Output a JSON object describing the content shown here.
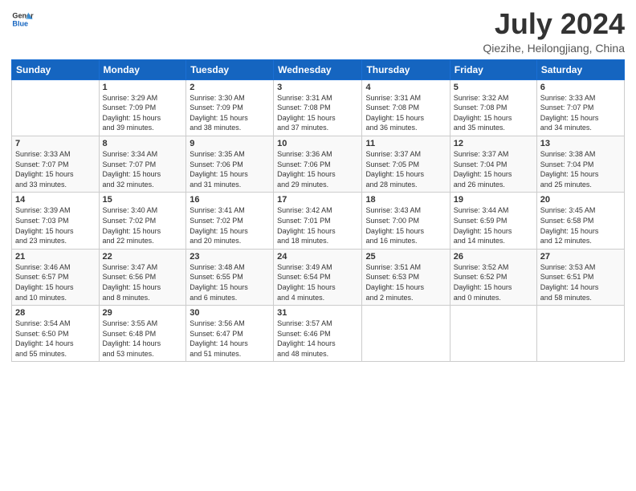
{
  "header": {
    "logo_line1": "General",
    "logo_line2": "Blue",
    "month_year": "July 2024",
    "location": "Qiezihe, Heilongjiang, China"
  },
  "weekdays": [
    "Sunday",
    "Monday",
    "Tuesday",
    "Wednesday",
    "Thursday",
    "Friday",
    "Saturday"
  ],
  "weeks": [
    [
      {
        "day": "",
        "info": ""
      },
      {
        "day": "1",
        "info": "Sunrise: 3:29 AM\nSunset: 7:09 PM\nDaylight: 15 hours\nand 39 minutes."
      },
      {
        "day": "2",
        "info": "Sunrise: 3:30 AM\nSunset: 7:09 PM\nDaylight: 15 hours\nand 38 minutes."
      },
      {
        "day": "3",
        "info": "Sunrise: 3:31 AM\nSunset: 7:08 PM\nDaylight: 15 hours\nand 37 minutes."
      },
      {
        "day": "4",
        "info": "Sunrise: 3:31 AM\nSunset: 7:08 PM\nDaylight: 15 hours\nand 36 minutes."
      },
      {
        "day": "5",
        "info": "Sunrise: 3:32 AM\nSunset: 7:08 PM\nDaylight: 15 hours\nand 35 minutes."
      },
      {
        "day": "6",
        "info": "Sunrise: 3:33 AM\nSunset: 7:07 PM\nDaylight: 15 hours\nand 34 minutes."
      }
    ],
    [
      {
        "day": "7",
        "info": "Sunrise: 3:33 AM\nSunset: 7:07 PM\nDaylight: 15 hours\nand 33 minutes."
      },
      {
        "day": "8",
        "info": "Sunrise: 3:34 AM\nSunset: 7:07 PM\nDaylight: 15 hours\nand 32 minutes."
      },
      {
        "day": "9",
        "info": "Sunrise: 3:35 AM\nSunset: 7:06 PM\nDaylight: 15 hours\nand 31 minutes."
      },
      {
        "day": "10",
        "info": "Sunrise: 3:36 AM\nSunset: 7:06 PM\nDaylight: 15 hours\nand 29 minutes."
      },
      {
        "day": "11",
        "info": "Sunrise: 3:37 AM\nSunset: 7:05 PM\nDaylight: 15 hours\nand 28 minutes."
      },
      {
        "day": "12",
        "info": "Sunrise: 3:37 AM\nSunset: 7:04 PM\nDaylight: 15 hours\nand 26 minutes."
      },
      {
        "day": "13",
        "info": "Sunrise: 3:38 AM\nSunset: 7:04 PM\nDaylight: 15 hours\nand 25 minutes."
      }
    ],
    [
      {
        "day": "14",
        "info": "Sunrise: 3:39 AM\nSunset: 7:03 PM\nDaylight: 15 hours\nand 23 minutes."
      },
      {
        "day": "15",
        "info": "Sunrise: 3:40 AM\nSunset: 7:02 PM\nDaylight: 15 hours\nand 22 minutes."
      },
      {
        "day": "16",
        "info": "Sunrise: 3:41 AM\nSunset: 7:02 PM\nDaylight: 15 hours\nand 20 minutes."
      },
      {
        "day": "17",
        "info": "Sunrise: 3:42 AM\nSunset: 7:01 PM\nDaylight: 15 hours\nand 18 minutes."
      },
      {
        "day": "18",
        "info": "Sunrise: 3:43 AM\nSunset: 7:00 PM\nDaylight: 15 hours\nand 16 minutes."
      },
      {
        "day": "19",
        "info": "Sunrise: 3:44 AM\nSunset: 6:59 PM\nDaylight: 15 hours\nand 14 minutes."
      },
      {
        "day": "20",
        "info": "Sunrise: 3:45 AM\nSunset: 6:58 PM\nDaylight: 15 hours\nand 12 minutes."
      }
    ],
    [
      {
        "day": "21",
        "info": "Sunrise: 3:46 AM\nSunset: 6:57 PM\nDaylight: 15 hours\nand 10 minutes."
      },
      {
        "day": "22",
        "info": "Sunrise: 3:47 AM\nSunset: 6:56 PM\nDaylight: 15 hours\nand 8 minutes."
      },
      {
        "day": "23",
        "info": "Sunrise: 3:48 AM\nSunset: 6:55 PM\nDaylight: 15 hours\nand 6 minutes."
      },
      {
        "day": "24",
        "info": "Sunrise: 3:49 AM\nSunset: 6:54 PM\nDaylight: 15 hours\nand 4 minutes."
      },
      {
        "day": "25",
        "info": "Sunrise: 3:51 AM\nSunset: 6:53 PM\nDaylight: 15 hours\nand 2 minutes."
      },
      {
        "day": "26",
        "info": "Sunrise: 3:52 AM\nSunset: 6:52 PM\nDaylight: 15 hours\nand 0 minutes."
      },
      {
        "day": "27",
        "info": "Sunrise: 3:53 AM\nSunset: 6:51 PM\nDaylight: 14 hours\nand 58 minutes."
      }
    ],
    [
      {
        "day": "28",
        "info": "Sunrise: 3:54 AM\nSunset: 6:50 PM\nDaylight: 14 hours\nand 55 minutes."
      },
      {
        "day": "29",
        "info": "Sunrise: 3:55 AM\nSunset: 6:48 PM\nDaylight: 14 hours\nand 53 minutes."
      },
      {
        "day": "30",
        "info": "Sunrise: 3:56 AM\nSunset: 6:47 PM\nDaylight: 14 hours\nand 51 minutes."
      },
      {
        "day": "31",
        "info": "Sunrise: 3:57 AM\nSunset: 6:46 PM\nDaylight: 14 hours\nand 48 minutes."
      },
      {
        "day": "",
        "info": ""
      },
      {
        "day": "",
        "info": ""
      },
      {
        "day": "",
        "info": ""
      }
    ]
  ]
}
